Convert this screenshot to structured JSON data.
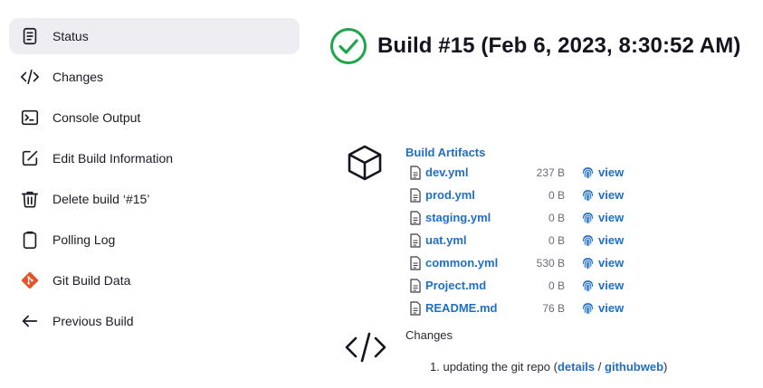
{
  "sidebar": {
    "items": [
      {
        "label": "Status",
        "icon": "document-icon",
        "active": true
      },
      {
        "label": "Changes",
        "icon": "code-icon"
      },
      {
        "label": "Console Output",
        "icon": "terminal-icon"
      },
      {
        "label": "Edit Build Information",
        "icon": "edit-icon"
      },
      {
        "label": "Delete build ‘#15’",
        "icon": "trash-icon"
      },
      {
        "label": "Polling Log",
        "icon": "clipboard-icon"
      },
      {
        "label": "Git Build Data",
        "icon": "git-icon"
      },
      {
        "label": "Previous Build",
        "icon": "arrow-left-icon"
      }
    ]
  },
  "build": {
    "title": "Build #15 (Feb 6, 2023, 8:30:52 AM)",
    "status": "success",
    "status_color": "#1ea64b"
  },
  "artifacts": {
    "title": "Build Artifacts",
    "view_label": "view",
    "files": [
      {
        "name": "dev.yml",
        "size": "237 B"
      },
      {
        "name": "prod.yml",
        "size": "0 B"
      },
      {
        "name": "staging.yml",
        "size": "0 B"
      },
      {
        "name": "uat.yml",
        "size": "0 B"
      },
      {
        "name": "common.yml",
        "size": "530 B"
      },
      {
        "name": "Project.md",
        "size": "0 B"
      },
      {
        "name": "README.md",
        "size": "76 B"
      }
    ]
  },
  "changes": {
    "label": "Changes",
    "items": [
      {
        "number": "1.",
        "text": "updating the git repo",
        "details_label": "details",
        "separator": "/",
        "web_label": "githubweb"
      }
    ]
  },
  "colors": {
    "link": "#1f6fc5",
    "accent_git": "#e8532a"
  }
}
